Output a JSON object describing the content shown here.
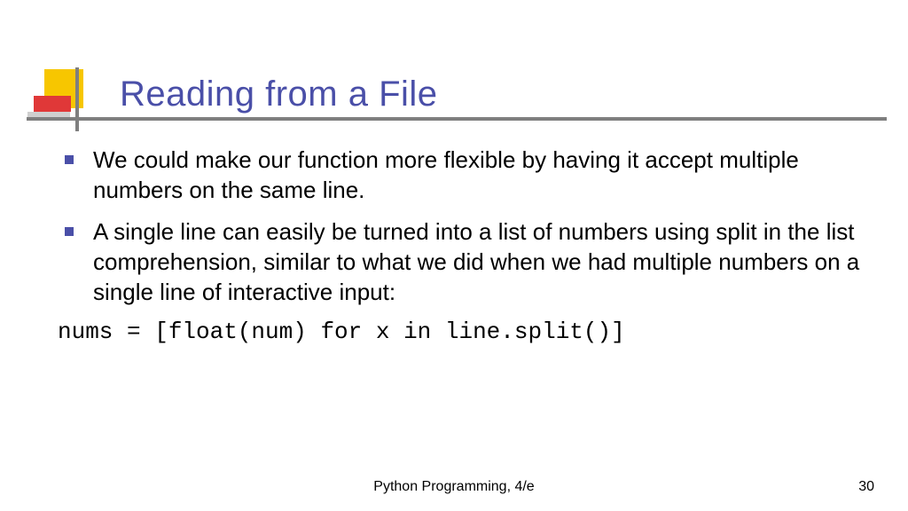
{
  "slide": {
    "title": "Reading from a File",
    "bullets": [
      "We could make our function more flexible by having it accept multiple numbers on the same line.",
      "A single line can easily be turned into a list of numbers using split in the list comprehension, similar to what we did when we had multiple numbers on a single line of interactive input:"
    ],
    "code": "nums = [float(num) for x in line.split()]",
    "footer_center": "Python Programming, 4/e",
    "footer_right": "30"
  }
}
